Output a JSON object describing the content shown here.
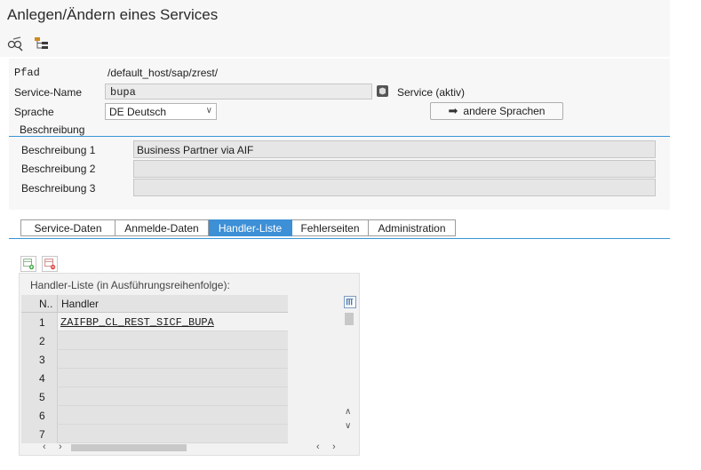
{
  "window": {
    "title": "Anlegen/Ändern eines Services"
  },
  "toolbar": {
    "icons": [
      "display-change-icon",
      "hierarchy-icon"
    ]
  },
  "form": {
    "path_label": "Pfad",
    "path_value": "/default_host/sap/zrest/",
    "service_name_label": "Service-Name",
    "service_name_value": "bupa",
    "service_status": "Service (aktiv)",
    "language_label": "Sprache",
    "language_value": "DE Deutsch",
    "other_languages_button": "andere Sprachen",
    "description_section": "Beschreibung",
    "descriptions": [
      {
        "label": "Beschreibung 1",
        "value": "Business Partner via AIF"
      },
      {
        "label": "Beschreibung 2",
        "value": ""
      },
      {
        "label": "Beschreibung 3",
        "value": ""
      }
    ]
  },
  "tabs": [
    {
      "label": "Service-Daten",
      "active": false
    },
    {
      "label": "Anmelde-Daten",
      "active": false
    },
    {
      "label": "Handler-Liste",
      "active": true
    },
    {
      "label": "Fehlerseiten",
      "active": false
    },
    {
      "label": "Administration",
      "active": false
    }
  ],
  "handler_list": {
    "title": "Handler-Liste (in Ausführungsreihenfolge):",
    "columns": {
      "num": "N..",
      "handler": "Handler"
    },
    "rows": [
      {
        "num": "1",
        "handler": "ZAIFBP_CL_REST_SICF_BUPA"
      },
      {
        "num": "2",
        "handler": ""
      },
      {
        "num": "3",
        "handler": ""
      },
      {
        "num": "4",
        "handler": ""
      },
      {
        "num": "5",
        "handler": ""
      },
      {
        "num": "6",
        "handler": ""
      },
      {
        "num": "7",
        "handler": ""
      }
    ]
  },
  "colors": {
    "accent": "#3d8fd6",
    "panel": "#f7f7f7"
  }
}
